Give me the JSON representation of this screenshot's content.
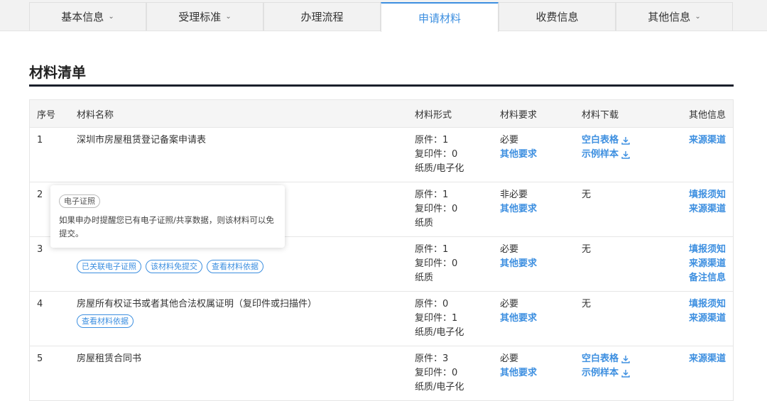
{
  "tabs": [
    {
      "label": "基本信息",
      "chevron": true
    },
    {
      "label": "受理标准",
      "chevron": true
    },
    {
      "label": "办理流程",
      "chevron": false
    },
    {
      "label": "申请材料",
      "chevron": false,
      "active": true
    },
    {
      "label": "收费信息",
      "chevron": false
    },
    {
      "label": "其他信息",
      "chevron": true
    }
  ],
  "section_title": "材料清单",
  "table": {
    "headers": [
      "序号",
      "材料名称",
      "材料形式",
      "材料要求",
      "材料下载",
      "其他信息"
    ],
    "rows": [
      {
        "no": "1",
        "name": "深圳市房屋租赁登记备案申请表",
        "form": [
          "原件：1",
          "复印件：0",
          "纸质/电子化"
        ],
        "req": "必要",
        "req_link": "其他要求",
        "downloads": [
          "空白表格",
          "示例样本"
        ],
        "others": [
          "来源渠道"
        ]
      },
      {
        "no": "2",
        "name": "",
        "form": [
          "原件：1",
          "复印件：0",
          "纸质"
        ],
        "req": "非必要",
        "req_link": "其他要求",
        "download_text": "无",
        "others": [
          "填报须知",
          "来源渠道"
        ]
      },
      {
        "no": "3",
        "name": "",
        "tags": [
          "已关联电子证照",
          "该材料免提交",
          "查看材料依据"
        ],
        "form": [
          "原件：1",
          "复印件：0",
          "纸质"
        ],
        "req": "必要",
        "req_link": "其他要求",
        "download_text": "无",
        "others": [
          "填报须知",
          "来源渠道",
          "备注信息"
        ]
      },
      {
        "no": "4",
        "name": "房屋所有权证书或者其他合法权属证明（复印件或扫描件）",
        "tags": [
          "查看材料依据"
        ],
        "form": [
          "原件：0",
          "复印件：1",
          "纸质/电子化"
        ],
        "req": "必要",
        "req_link": "其他要求",
        "download_text": "无",
        "others": [
          "填报须知",
          "来源渠道"
        ]
      },
      {
        "no": "5",
        "name": "房屋租赁合同书",
        "form": [
          "原件：3",
          "复印件：0",
          "纸质/电子化"
        ],
        "req": "必要",
        "req_link": "其他要求",
        "downloads": [
          "空白表格",
          "示例样本"
        ],
        "others": [
          "来源渠道"
        ]
      }
    ]
  },
  "tooltip": {
    "badge": "电子证照",
    "text": "如果申办时提醒您已有电子证照/共享数据，则该材料可以免提交。"
  },
  "colors": {
    "accent": "#3d8fe0",
    "title_rule": "#1a1f2b"
  },
  "icons": {
    "download": "download-icon",
    "chevron": "chevron-down-icon"
  }
}
